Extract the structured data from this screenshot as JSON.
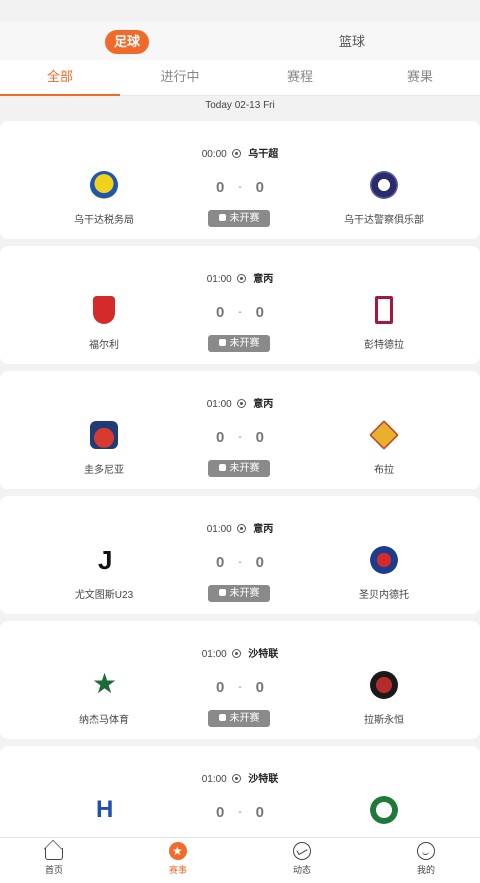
{
  "sport_switch": {
    "active": "足球",
    "inactive": "篮球"
  },
  "tabs": [
    "全部",
    "进行中",
    "赛程",
    "赛果"
  ],
  "date": "Today 02-13 Fri",
  "matches": [
    {
      "time": "00:00",
      "league": "乌干超",
      "home": "乌干达税务局",
      "away": "乌干达警察俱乐部",
      "home_score": "0",
      "away_score": "0",
      "status": "未开赛"
    },
    {
      "time": "01:00",
      "league": "意丙",
      "home": "福尔利",
      "away": "彭特德拉",
      "home_score": "0",
      "away_score": "0",
      "status": "未开赛"
    },
    {
      "time": "01:00",
      "league": "意丙",
      "home": "圭多尼亚",
      "away": "布拉",
      "home_score": "0",
      "away_score": "0",
      "status": "未开赛"
    },
    {
      "time": "01:00",
      "league": "意丙",
      "home": "尤文图斯U23",
      "away": "圣贝内德托",
      "home_score": "0",
      "away_score": "0",
      "status": "未开赛"
    },
    {
      "time": "01:00",
      "league": "沙特联",
      "home": "纳杰马体育",
      "away": "拉斯永恒",
      "home_score": "0",
      "away_score": "0",
      "status": "未开赛"
    },
    {
      "time": "01:00",
      "league": "沙特联",
      "home": "",
      "away": "",
      "home_score": "0",
      "away_score": "0",
      "status": ""
    }
  ],
  "score_dash": "-",
  "bottom_nav": [
    "首页",
    "赛事",
    "动态",
    "我的"
  ],
  "colors": {
    "accent": "#f26a2a",
    "status_bg": "#8a8a8a"
  }
}
